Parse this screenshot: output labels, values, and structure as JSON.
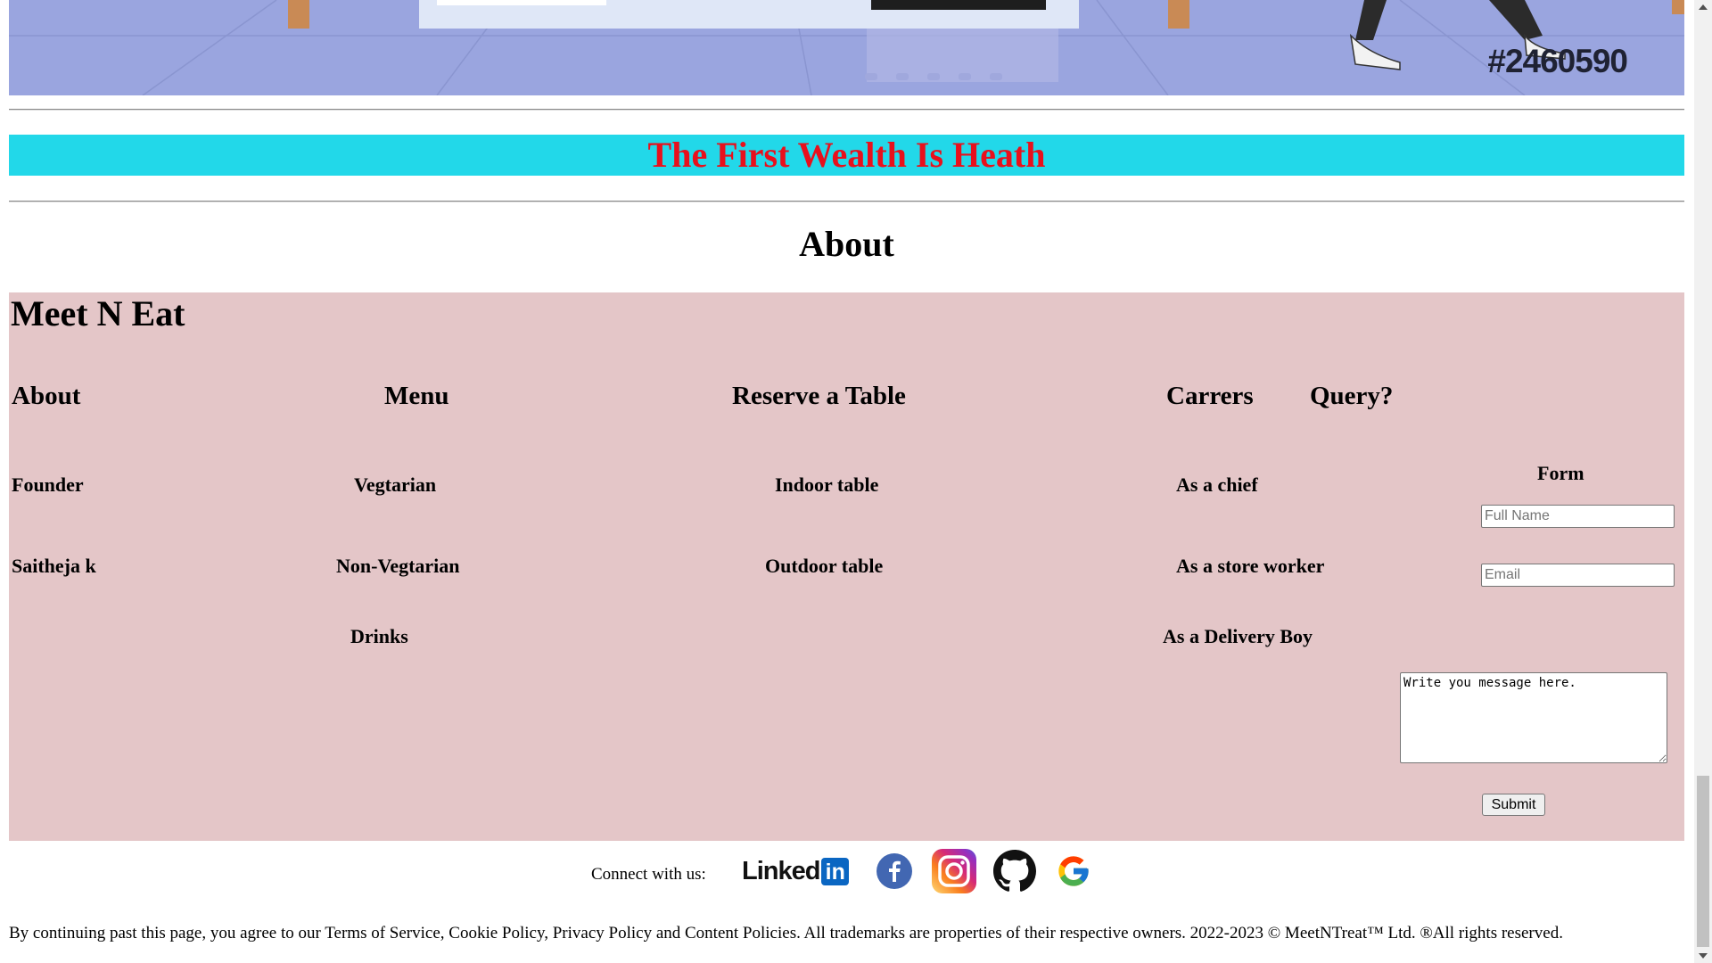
{
  "hero": {
    "tag": "#2460590"
  },
  "banner": {
    "text": "The First Wealth Is Heath"
  },
  "about_title": "About",
  "footer": {
    "brand": "Meet N Eat",
    "columns": [
      {
        "heading": "About",
        "items": [
          "Founder",
          "Saitheja k"
        ]
      },
      {
        "heading": "Menu",
        "items": [
          "Vegtarian",
          "Non-Vegtarian",
          "Drinks"
        ]
      },
      {
        "heading": "Reserve a Table",
        "items": [
          "Indoor table",
          "Outdoor table"
        ]
      },
      {
        "heading": "Carrers",
        "items": [
          "As a chief",
          "As a store worker",
          "As a Delivery Boy"
        ]
      },
      {
        "heading": "Query?"
      }
    ],
    "form": {
      "title": "Form",
      "name_placeholder": "Full Name",
      "email_placeholder": "Email",
      "message_value": "Write you message here.",
      "submit_label": "Submit"
    }
  },
  "connect": {
    "label": "Connect with us:",
    "icons": [
      "linkedin-icon",
      "facebook-icon",
      "instagram-icon",
      "github-icon",
      "google-icon"
    ],
    "linkedin_text": "Linked",
    "linkedin_badge": "in"
  },
  "legal": "By continuing past this page, you agree to our Terms of Service, Cookie Policy, Privacy Policy and Content Policies. All trademarks are properties of their respective owners. 2022-2023 © MeetNTreat™ Ltd. ®All rights reserved.",
  "colors": {
    "banner_bg": "#22d8e9",
    "banner_text": "#e8101c",
    "footer_bg": "#e4c6c8",
    "hero_bg": "#9aa5df"
  }
}
